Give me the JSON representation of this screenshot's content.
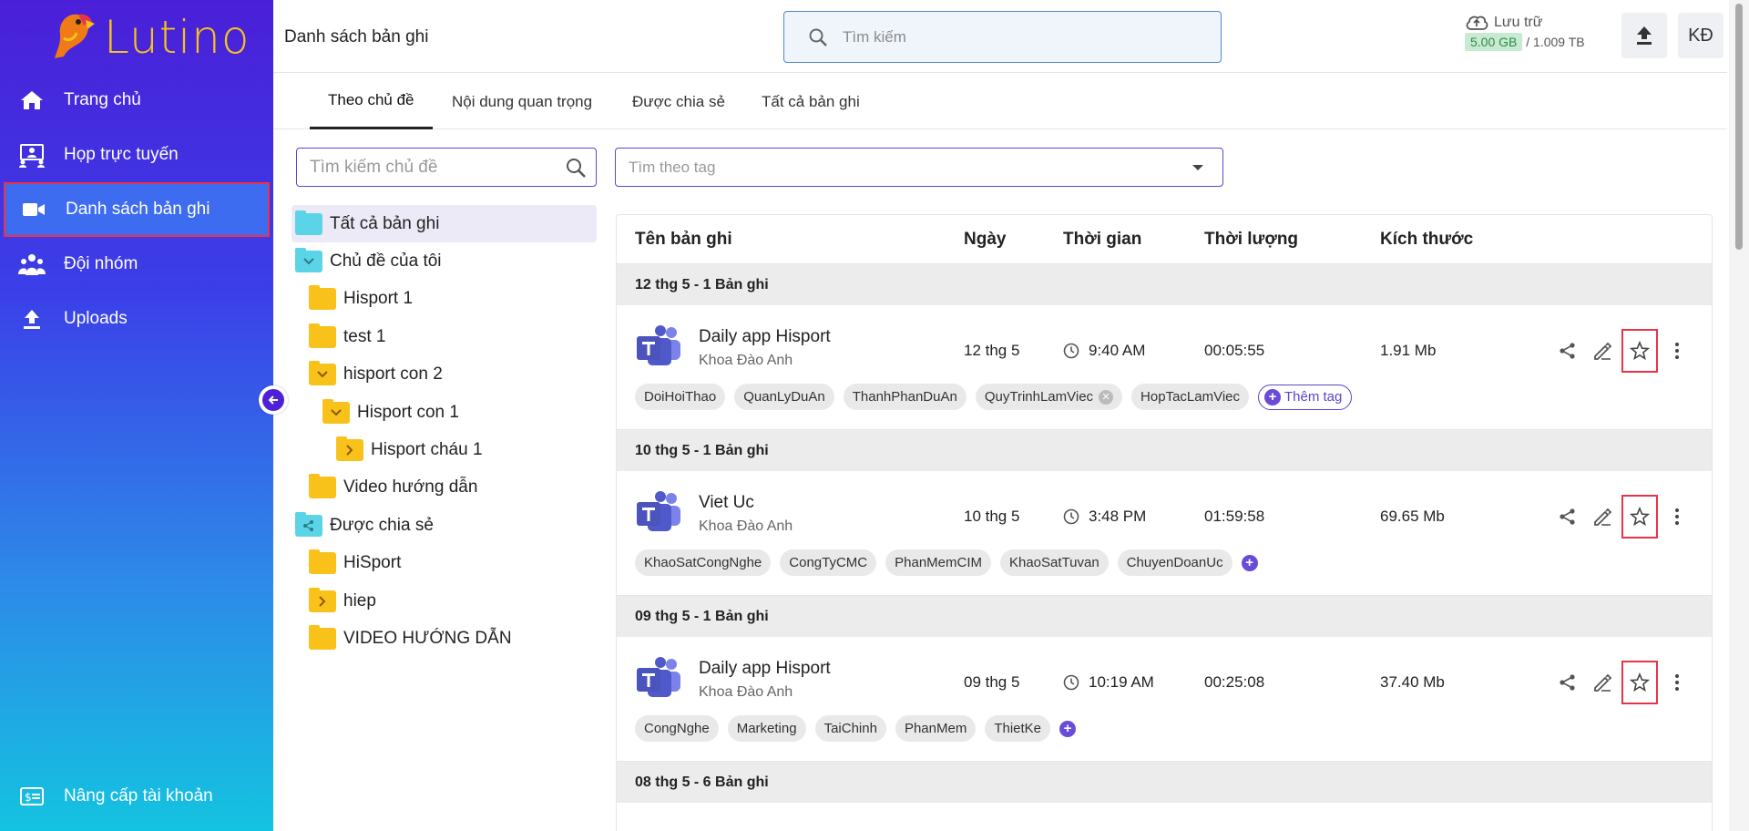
{
  "app": {
    "logo_text": "Lutino",
    "brand_color": "#f6c21c",
    "sidebar_gradient": [
      "#4a1fd8",
      "#14c3e0"
    ]
  },
  "sidebar": {
    "items": [
      {
        "label": "Trang chủ",
        "icon": "home-icon"
      },
      {
        "label": "Họp trực tuyến",
        "icon": "meeting-icon"
      },
      {
        "label": "Danh sách bản ghi",
        "icon": "video-camera-icon",
        "active": true
      },
      {
        "label": "Đội nhóm",
        "icon": "team-icon"
      },
      {
        "label": "Uploads",
        "icon": "upload-icon"
      }
    ],
    "bottom": {
      "label": "Nâng cấp tài khoản",
      "icon": "upgrade-icon"
    }
  },
  "header": {
    "title": "Danh sách bản ghi",
    "search_placeholder": "Tìm kiếm",
    "storage_label": "Lưu trữ",
    "storage_used": "5.00 GB",
    "storage_total": "/ 1.009 TB",
    "avatar": "KĐ"
  },
  "tabs": [
    {
      "label": "Theo chủ đề",
      "active": true
    },
    {
      "label": "Nội dung quan trọng"
    },
    {
      "label": "Được chia sẻ"
    },
    {
      "label": "Tất cả bản ghi"
    }
  ],
  "topics": {
    "search_placeholder": "Tìm kiếm chủ đề",
    "tree": [
      {
        "label": "Tất cả bản ghi",
        "level": 0,
        "kind": "cyan",
        "selected": true
      },
      {
        "label": "Chủ đề của tôi",
        "level": 0,
        "kind": "cyan",
        "expanded": true
      },
      {
        "label": "Hisport 1",
        "level": 1,
        "kind": "yellow"
      },
      {
        "label": "test 1",
        "level": 1,
        "kind": "yellow"
      },
      {
        "label": "hisport con 2",
        "level": 1,
        "kind": "yellow",
        "expanded": true
      },
      {
        "label": "Hisport con 1",
        "level": 2,
        "kind": "yellow",
        "expanded": true
      },
      {
        "label": "Hisport cháu 1",
        "level": 3,
        "kind": "yellow",
        "collapsed": true
      },
      {
        "label": "Video hướng dẫn",
        "level": 1,
        "kind": "yellow"
      },
      {
        "label": "Được chia sẻ",
        "level": 0,
        "kind": "cyan-share"
      },
      {
        "label": "HiSport",
        "level": 1,
        "kind": "yellow"
      },
      {
        "label": "hiep",
        "level": 1,
        "kind": "yellow",
        "collapsed": true
      },
      {
        "label": "VIDEO HƯỚNG DẪN",
        "level": 1,
        "kind": "yellow"
      }
    ]
  },
  "tag_filter": {
    "placeholder": "Tìm theo tag"
  },
  "table": {
    "columns": [
      "Tên bản ghi",
      "Ngày",
      "Thời gian",
      "Thời lượng",
      "Kích thước"
    ],
    "groups": [
      {
        "label": "12 thg 5 - 1 Bản ghi",
        "records": [
          {
            "title": "Daily app Hisport",
            "owner": "Khoa Đào Anh",
            "date": "12 thg 5",
            "time": "9:40 AM",
            "duration": "00:05:55",
            "size": "1.91 Mb",
            "tags": [
              "DoiHoiThao",
              "QuanLyDuAn",
              "ThanhPhanDuAn",
              "QuyTrinhLamViec",
              "HopTacLamViec"
            ],
            "add_tag_label": "Thêm tag"
          }
        ]
      },
      {
        "label": "10 thg 5 - 1 Bản ghi",
        "records": [
          {
            "title": "Viet Uc",
            "owner": "Khoa Đào Anh",
            "date": "10 thg 5",
            "time": "3:48 PM",
            "duration": "01:59:58",
            "size": "69.65 Mb",
            "tags": [
              "KhaoSatCongNghe",
              "CongTyCMC",
              "PhanMemCIM",
              "KhaoSatTuvan",
              "ChuyenDoanUc"
            ]
          }
        ]
      },
      {
        "label": "09 thg 5 - 1 Bản ghi",
        "records": [
          {
            "title": "Daily app Hisport",
            "owner": "Khoa Đào Anh",
            "date": "09 thg 5",
            "time": "10:19 AM",
            "duration": "00:25:08",
            "size": "37.40 Mb",
            "tags": [
              "CongNghe",
              "Marketing",
              "TaiChinh",
              "PhanMem",
              "ThietKe"
            ]
          }
        ]
      },
      {
        "label": "08 thg 5 - 6 Bản ghi",
        "records": []
      }
    ]
  }
}
